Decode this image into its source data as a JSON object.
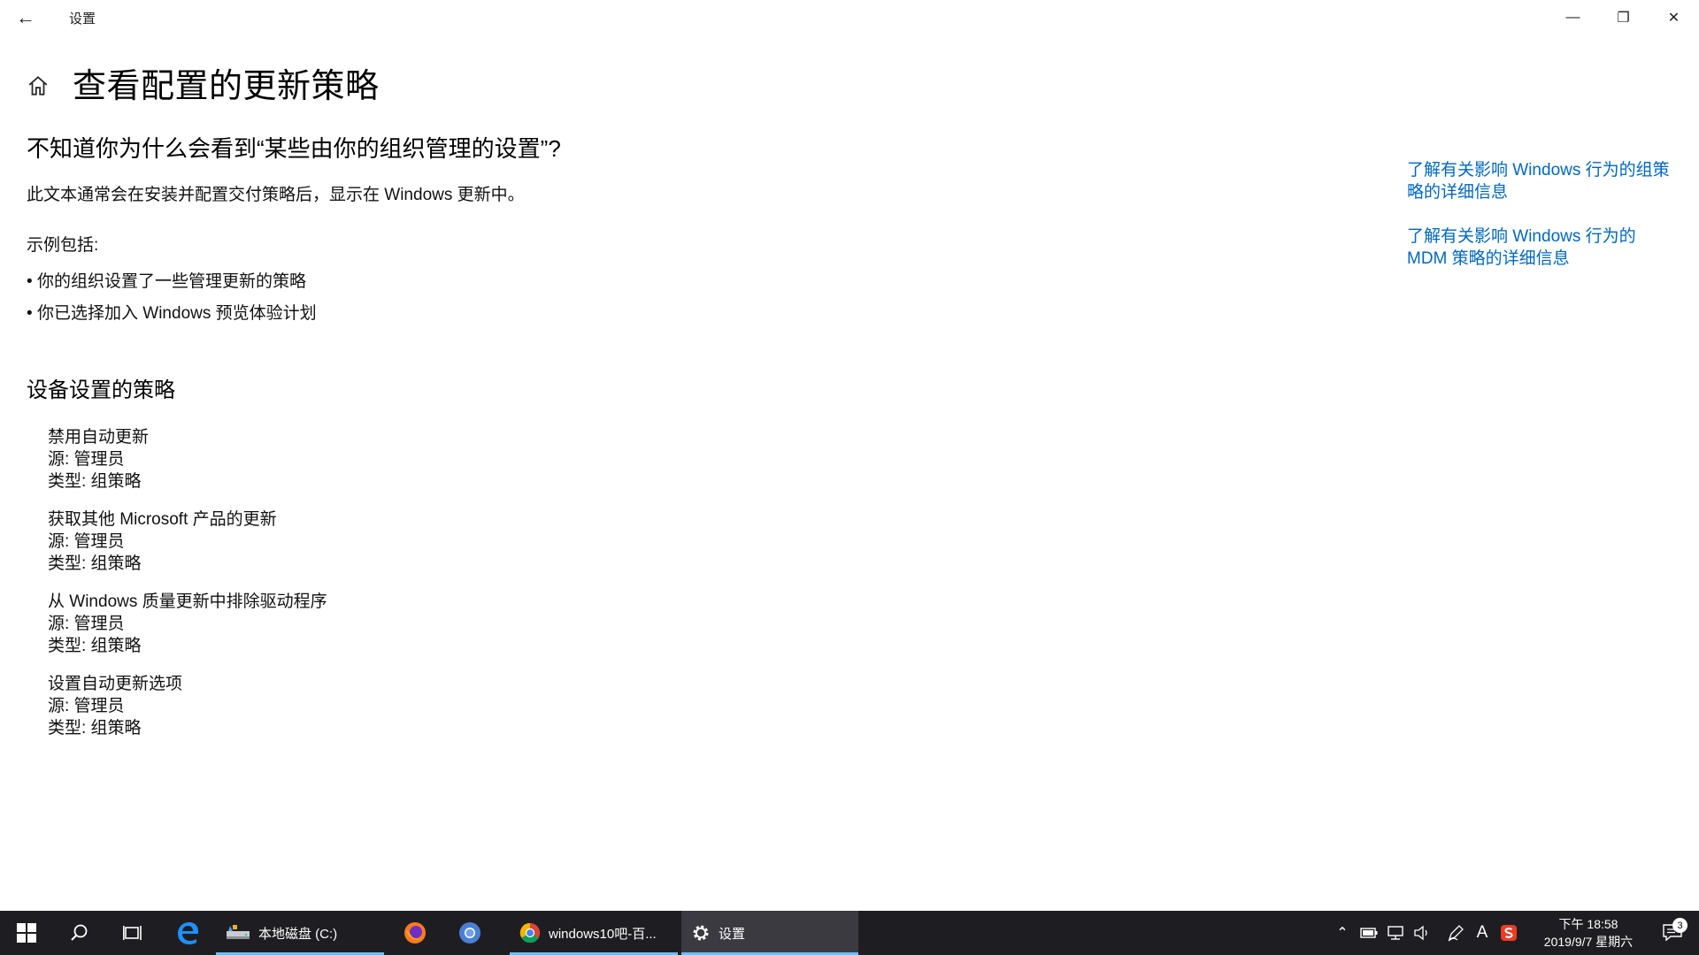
{
  "window": {
    "title": "设置",
    "controls": {
      "minimize": "—",
      "restore": "❐",
      "close": "✕"
    }
  },
  "page": {
    "title": "查看配置的更新策略",
    "question": "不知道你为什么会看到“某些由你的组织管理的设置”?",
    "description": "此文本通常会在安装并配置交付策略后，显示在 Windows 更新中。",
    "examples_label": "示例包括:",
    "examples": [
      "你的组织设置了一些管理更新的策略",
      "你已选择加入 Windows 预览体验计划"
    ],
    "section_heading": "设备设置的策略",
    "policies": [
      {
        "name": "禁用自动更新",
        "source": "源: 管理员",
        "type": "类型: 组策略"
      },
      {
        "name": "获取其他 Microsoft 产品的更新",
        "source": "源: 管理员",
        "type": "类型: 组策略"
      },
      {
        "name": "从 Windows 质量更新中排除驱动程序",
        "source": "源: 管理员",
        "type": "类型: 组策略"
      },
      {
        "name": "设置自动更新选项",
        "source": "源: 管理员",
        "type": "类型: 组策略"
      }
    ]
  },
  "related_links": [
    "了解有关影响 Windows 行为的组策略的详细信息",
    "了解有关影响 Windows 行为的 MDM 策略的详细信息"
  ],
  "taskbar": {
    "apps": [
      {
        "label": "本地磁盘 (C:)"
      },
      {
        "label": "windows10吧-百..."
      },
      {
        "label": "设置"
      }
    ],
    "tray": {
      "ime": "A",
      "clock_time": "下午 18:58",
      "clock_date": "2019/9/7 星期六",
      "notification_count": "3"
    }
  },
  "colors": {
    "link": "#0067c0",
    "taskbar_bg": "#1e1e22",
    "taskbar_accent": "#76b9ed"
  }
}
